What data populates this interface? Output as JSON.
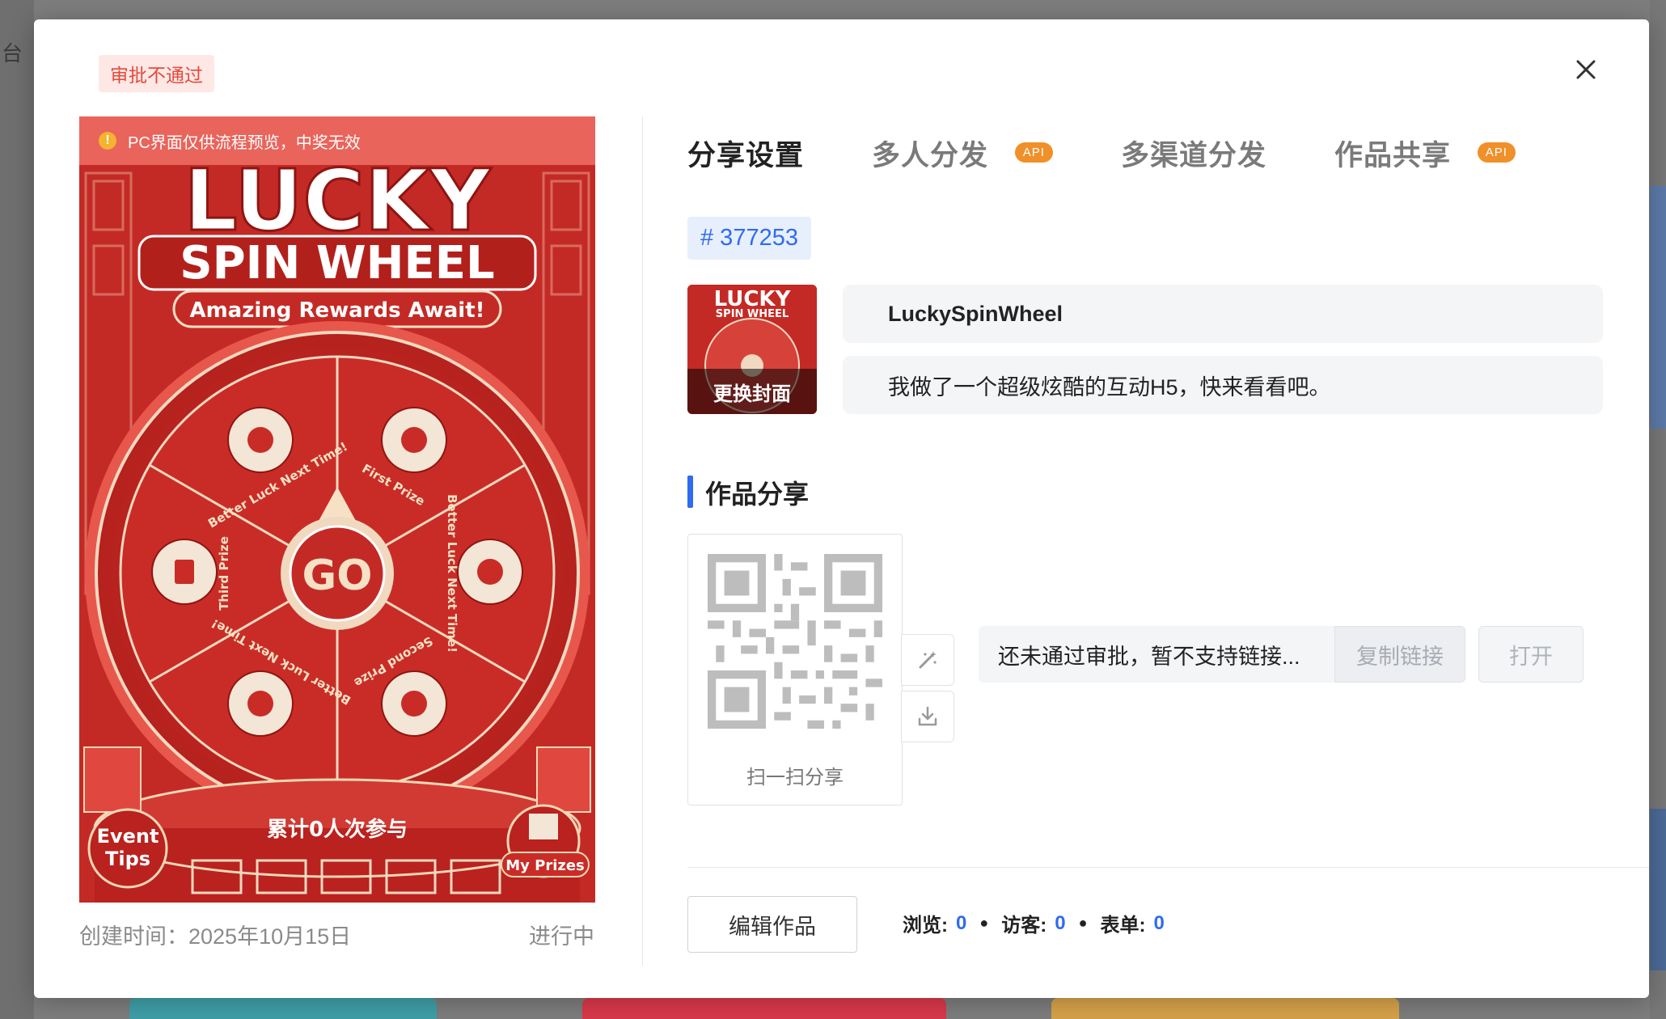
{
  "backdrop": {
    "left_text": "台"
  },
  "modal": {
    "status_tag": "审批不通过",
    "preview": {
      "warning": "PC界面仅供流程预览，中奖无效",
      "poster": {
        "headline_1": "LUCKY",
        "headline_2": "SPIN WHEEL",
        "subtitle": "Amazing Rewards Await!",
        "center_label": "GO",
        "segments": [
          "First Prize",
          "Better Luck Next Time!",
          "Second Prize",
          "Better Luck Next Time!",
          "Third Prize",
          "Better Luck Next Time!"
        ],
        "participants": "累计0人次参与",
        "event_tips": [
          "Event",
          "Tips"
        ],
        "my_prizes": "My Prizes"
      }
    },
    "created": "创建时间：2025年10月15日",
    "status_text": "进行中",
    "tabs": [
      {
        "label": "分享设置",
        "active": true,
        "api": false
      },
      {
        "label": "多人分发",
        "active": false,
        "api": true
      },
      {
        "label": "多渠道分发",
        "active": false,
        "api": false
      },
      {
        "label": "作品共享",
        "active": false,
        "api": true
      }
    ],
    "api_label": "API",
    "work_id": "# 377253",
    "cover_label": "更换封面",
    "title_value": "LuckySpinWheel",
    "description_value": "我做了一个超级炫酷的互动H5，快来看看吧。",
    "section_title": "作品分享",
    "qr_caption": "扫一扫分享",
    "link_text": "还未通过审批，暂不支持链接...",
    "copy_button": "复制链接",
    "open_button": "打开",
    "edit_button": "编辑作品",
    "stats": [
      {
        "label": "浏览:",
        "value": "0"
      },
      {
        "label": "访客:",
        "value": "0"
      },
      {
        "label": "表单:",
        "value": "0"
      }
    ],
    "colors": {
      "accent": "#2f6bf0",
      "danger": "#e64a3b",
      "api": "#f0902a",
      "wheel_red": "#c92c26"
    }
  }
}
